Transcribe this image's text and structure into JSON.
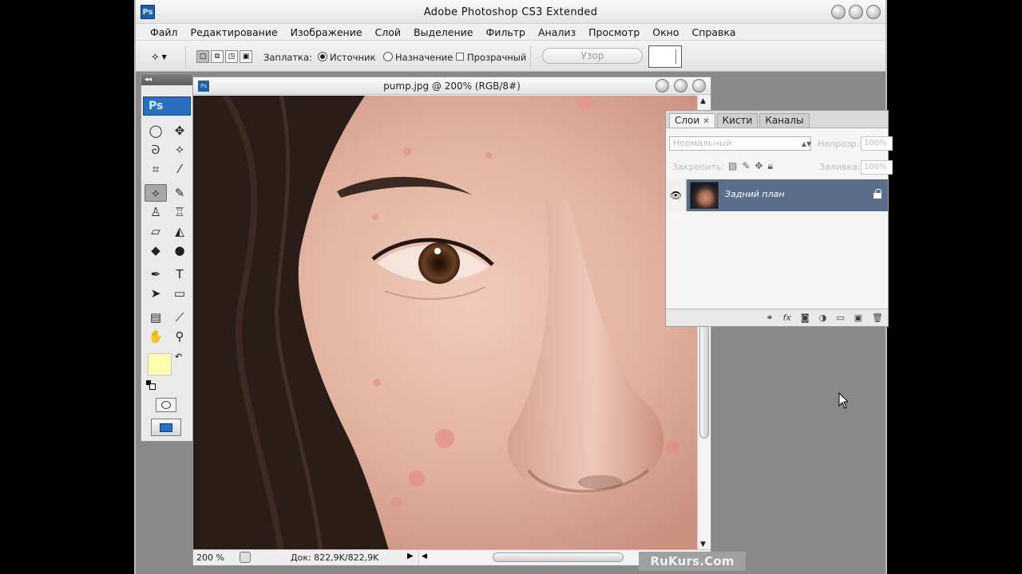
{
  "window": {
    "title": "Adobe Photoshop CS3 Extended",
    "logo": "Ps"
  },
  "menu": [
    "Файл",
    "Редактирование",
    "Изображение",
    "Слой",
    "Выделение",
    "Фильтр",
    "Анализ",
    "Просмотр",
    "Окно",
    "Справка"
  ],
  "options": {
    "tool_icon": "patch-tool-icon",
    "patch_label": "Заплатка:",
    "source_label": "Источник",
    "destination_label": "Назначение",
    "transparent_label": "Прозрачный",
    "pattern_button": "Узор",
    "selected_mode": "source",
    "transparent_checked": false
  },
  "toolbox": {
    "logo": "Ps",
    "collapse": "◂◂",
    "foreground_color": "#fbffb0",
    "background_color": "#ffffff",
    "active_tool": "patch-tool-icon",
    "tools": [
      {
        "name": "marquee-tool-icon",
        "glyph": "◯"
      },
      {
        "name": "move-tool-icon",
        "glyph": "✥"
      },
      {
        "name": "lasso-tool-icon",
        "glyph": "ᘐ"
      },
      {
        "name": "magic-wand-tool-icon",
        "glyph": "✧"
      },
      {
        "name": "crop-tool-icon",
        "glyph": "⌗"
      },
      {
        "name": "slice-tool-icon",
        "glyph": "⁄"
      },
      {
        "name": "patch-tool-icon",
        "glyph": "⟡"
      },
      {
        "name": "brush-tool-icon",
        "glyph": "✎"
      },
      {
        "name": "stamp-tool-icon",
        "glyph": "♙"
      },
      {
        "name": "history-brush-tool-icon",
        "glyph": "♖"
      },
      {
        "name": "eraser-tool-icon",
        "glyph": "▱"
      },
      {
        "name": "paint-bucket-tool-icon",
        "glyph": "◭"
      },
      {
        "name": "blur-tool-icon",
        "glyph": "◆"
      },
      {
        "name": "dodge-tool-icon",
        "glyph": "●"
      },
      {
        "name": "pen-tool-icon",
        "glyph": "✒"
      },
      {
        "name": "type-tool-icon",
        "glyph": "T"
      },
      {
        "name": "path-selection-tool-icon",
        "glyph": "➤"
      },
      {
        "name": "rectangle-tool-icon",
        "glyph": "▭"
      },
      {
        "name": "notes-tool-icon",
        "glyph": "▤"
      },
      {
        "name": "eyedropper-tool-icon",
        "glyph": "⟋"
      },
      {
        "name": "hand-tool-icon",
        "glyph": "✋"
      },
      {
        "name": "zoom-tool-icon",
        "glyph": "⚲"
      }
    ]
  },
  "document": {
    "title": "pump.jpg @ 200% (RGB/8#)",
    "zoom": "200 %",
    "info": "Док: 822,9K/822,9K"
  },
  "layers_panel": {
    "tabs": [
      "Слои",
      "Кисти",
      "Каналы"
    ],
    "active_tab": "Слои",
    "blend_mode": "Нормальный",
    "opacity_label": "Непрозр.:",
    "opacity_value": "100%",
    "lock_label": "Закрепить:",
    "fill_label": "Заливка:",
    "fill_value": "100%",
    "layers": [
      {
        "name": "Задний план",
        "visible": true,
        "locked": true
      }
    ]
  },
  "watermark": "RuKurs.Com"
}
